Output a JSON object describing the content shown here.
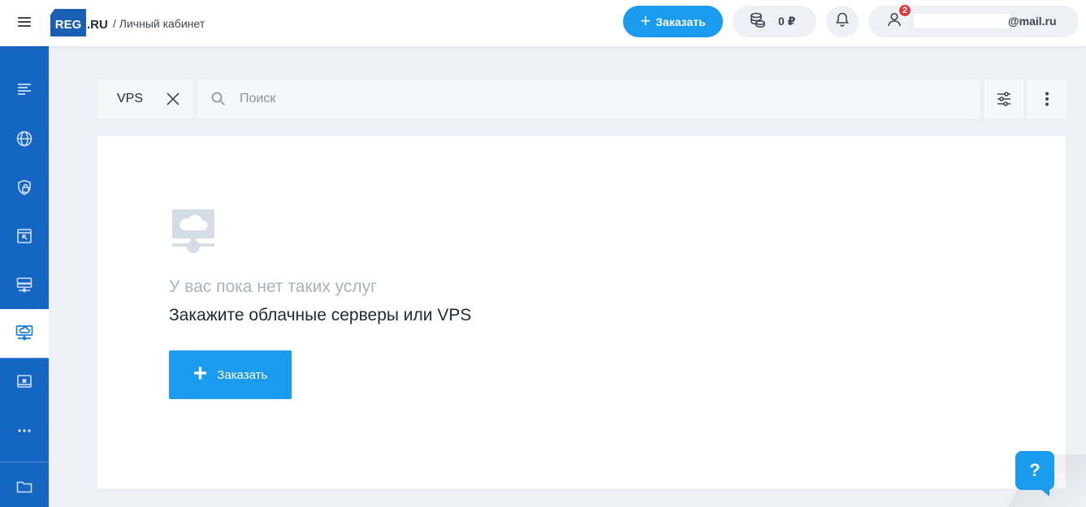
{
  "header": {
    "logo_text": "REG",
    "logo_suffix": ".RU",
    "breadcrumb": "/ Личный кабинет",
    "order_button": "Заказать",
    "balance": "0 ₽",
    "notifications_badge": "2",
    "account_email": "@mail.ru"
  },
  "sidebar": {
    "items": [
      {
        "icon": "list-icon"
      },
      {
        "icon": "globe-icon"
      },
      {
        "icon": "shield-lock-icon"
      },
      {
        "icon": "browser-window-icon"
      },
      {
        "icon": "server-icon"
      },
      {
        "icon": "cloud-server-icon",
        "active": true
      },
      {
        "icon": "monitor-icon"
      },
      {
        "icon": "more-icon"
      },
      {
        "icon": "folder-icon"
      }
    ]
  },
  "toolbar": {
    "filter_chip": "VPS",
    "search_placeholder": "Поиск"
  },
  "empty_state": {
    "title": "У вас пока нет таких услуг",
    "subtitle": "Закажите облачные серверы или VPS",
    "order_button": "Заказать"
  },
  "help": {
    "label": "?"
  },
  "colors": {
    "brand": "#1566c2",
    "accent": "#1a9bf0",
    "badge": "#e53935"
  }
}
